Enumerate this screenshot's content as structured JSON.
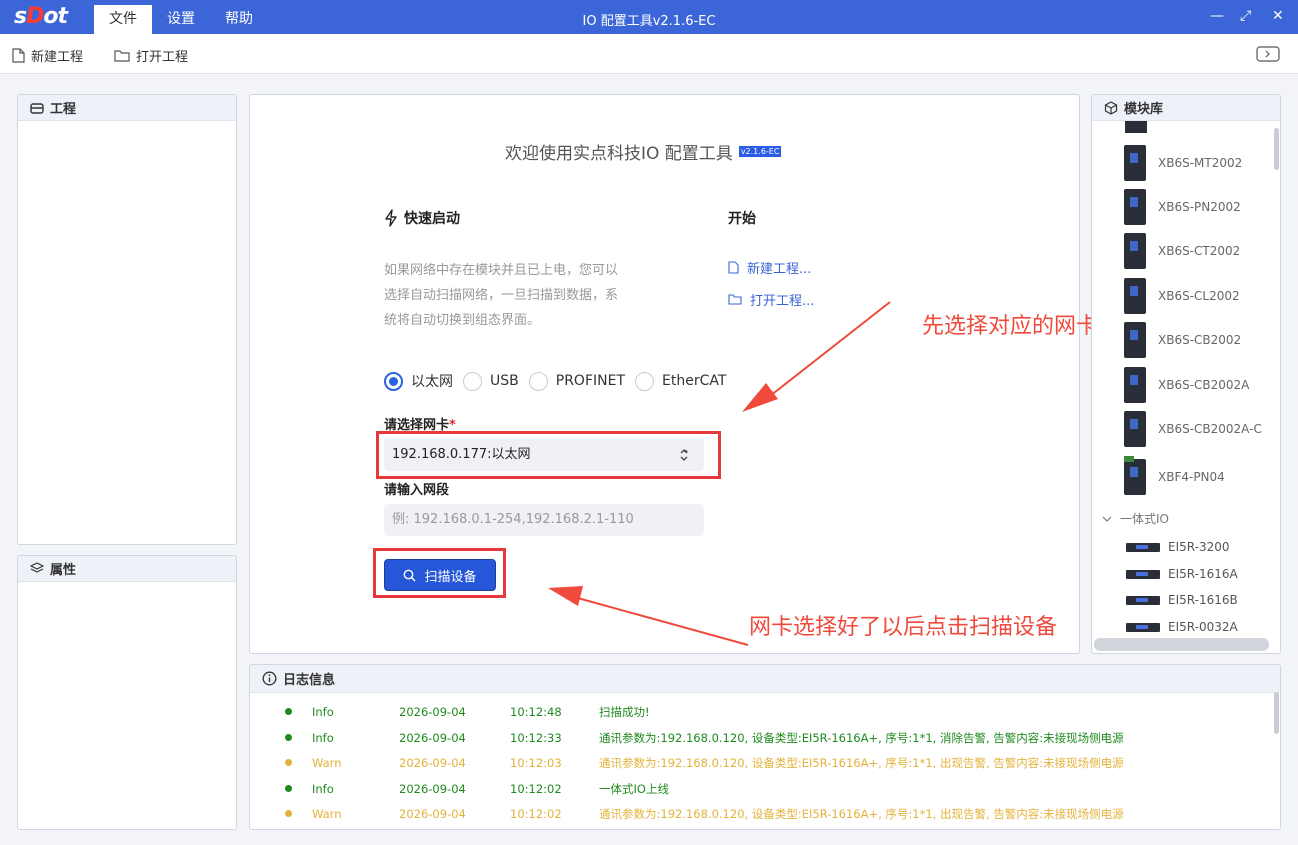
{
  "app": {
    "logo_prefix": "s",
    "logo_dot": "D",
    "logo_suffix": "ot",
    "title": "IO 配置工具v2.1.6-EC",
    "menu": [
      "文件",
      "设置",
      "帮助"
    ],
    "window_controls": [
      "—",
      "⤢",
      "✕"
    ]
  },
  "toolbar": {
    "new_project": "新建工程",
    "open_project": "打开工程"
  },
  "panels": {
    "project": "工程",
    "properties": "属性",
    "module_lib": "模块库",
    "log": "日志信息"
  },
  "welcome": {
    "title": "欢迎使用实点科技IO 配置工具",
    "version_badge": "v2.1.6-EC",
    "quick_start": "快速启动",
    "start": "开始",
    "description": "如果网络中存在模块并且已上电，您可以选择自动扫描网络，一旦扫描到数据，系统将自动切换到组态界面。",
    "new_link": "新建工程...",
    "open_link": "打开工程...",
    "protocols": [
      {
        "label": "以太网",
        "selected": true
      },
      {
        "label": "USB",
        "selected": false
      },
      {
        "label": "PROFINET",
        "selected": false
      },
      {
        "label": "EtherCAT",
        "selected": false
      }
    ],
    "nic_label": "请选择网卡",
    "required_mark": "*",
    "nic_value": "192.168.0.177:以太网",
    "segment_label": "请输入网段",
    "segment_placeholder": "例: 192.168.0.1-254,192.168.2.1-110",
    "scan_button": "扫描设备"
  },
  "annotations": {
    "nic_hint": "先选择对应的网卡",
    "scan_hint": "网卡选择好了以后点击扫描设备"
  },
  "module_library": {
    "modules": [
      "XB6S-MT2002",
      "XB6S-PN2002",
      "XB6S-CT2002",
      "XB6S-CL2002",
      "XB6S-CB2002",
      "XB6S-CB2002A",
      "XB6S-CB2002A-C",
      "XBF4-PN04"
    ],
    "group": "一体式IO",
    "group_items": [
      "EI5R-3200",
      "EI5R-1616A",
      "EI5R-1616B",
      "EI5R-0032A"
    ]
  },
  "colors": {
    "accent": "#3c65d8",
    "info": "#1e8a1e",
    "warn": "#e3b23a",
    "annotation": "#ef4a3c"
  },
  "logs": [
    {
      "level": "Info",
      "date": "2026-09-04",
      "time": "10:12:48",
      "msg": "扫描成功!"
    },
    {
      "level": "Info",
      "date": "2026-09-04",
      "time": "10:12:33",
      "msg": "通讯参数为:192.168.0.120, 设备类型:EI5R-1616A+, 序号:1*1, 消除告警, 告警内容:未接现场侧电源"
    },
    {
      "level": "Warn",
      "date": "2026-09-04",
      "time": "10:12:03",
      "msg": "通讯参数为:192.168.0.120, 设备类型:EI5R-1616A+, 序号:1*1, 出现告警, 告警内容:未接现场侧电源"
    },
    {
      "level": "Info",
      "date": "2026-09-04",
      "time": "10:12:02",
      "msg": "一体式IO上线"
    },
    {
      "level": "Warn",
      "date": "2026-09-04",
      "time": "10:12:02",
      "msg": "通讯参数为:192.168.0.120, 设备类型:EI5R-1616A+, 序号:1*1, 出现告警, 告警内容:未接现场侧电源"
    }
  ]
}
